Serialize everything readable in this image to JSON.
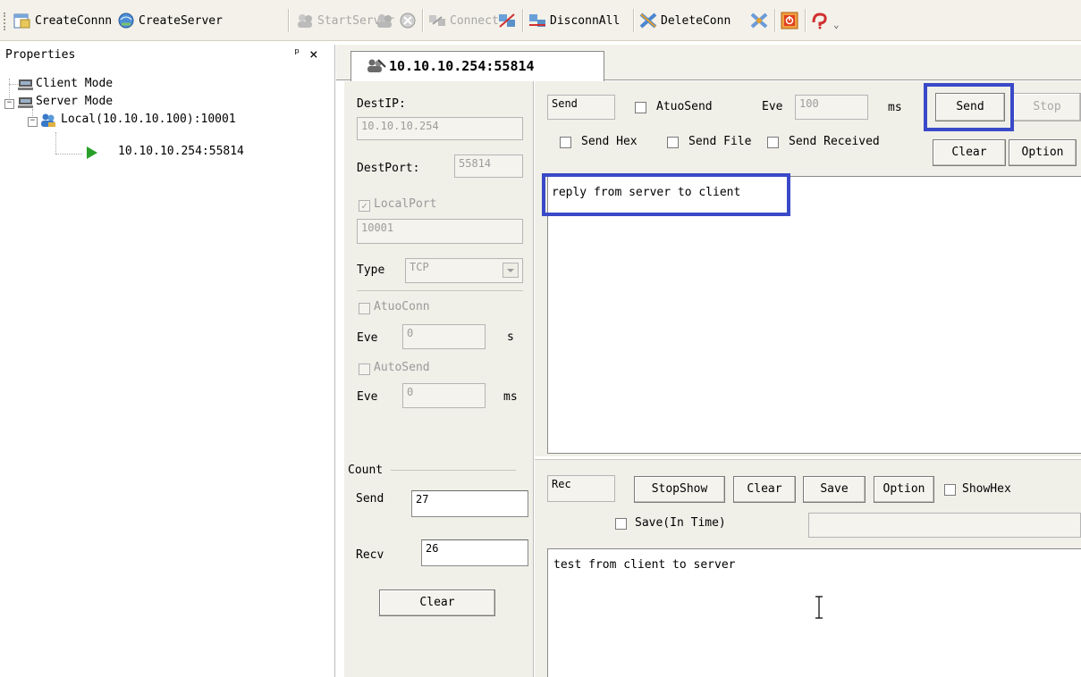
{
  "toolbar": {
    "create_conn": "CreateConnn",
    "create_server": "CreateServer",
    "start_server": "StartServer",
    "connect": "Connect",
    "disconn_all": "DisconnAll",
    "delete_conn": "DeleteConn",
    "overflow": "⌄"
  },
  "props": {
    "title": "Properties",
    "pin": "ᵖ",
    "close": "×",
    "tree": {
      "client_mode": "Client Mode",
      "server_mode": "Server Mode",
      "local": "Local(10.10.10.100):10001",
      "remote": "10.10.10.254:55814",
      "expand_minus": "−"
    }
  },
  "tab": {
    "label": "10.10.10.254:55814"
  },
  "form": {
    "dest_ip_label": "DestIP:",
    "dest_ip_value": "10.10.10.254",
    "dest_port_label": "DestPort:",
    "dest_port_value": "55814",
    "local_port_label": "LocalPort",
    "local_port_value": "10001",
    "type_label": "Type",
    "type_value": "TCP",
    "atuo_conn_label": "AtuoConn",
    "eve_label": "Eve",
    "eve_conn_value": "0",
    "eve_conn_unit": "s",
    "auto_send_label": "AutoSend",
    "eve_send_value": "0",
    "eve_send_unit": "ms",
    "count_label": "Count",
    "send_label": "Send",
    "send_count": "27",
    "recv_label": "Recv",
    "recv_count": "26",
    "clear_label": "Clear"
  },
  "send": {
    "group_label": "Send",
    "atuo_send_label": "AtuoSend",
    "eve_label": "Eve",
    "eve_value": "100",
    "eve_unit": "ms",
    "send_button": "Send",
    "stop_button": "Stop",
    "send_hex": "Send Hex",
    "send_file": "Send File",
    "send_received": "Send Received",
    "clear_button": "Clear",
    "option_button": "Option",
    "text": "reply from server to client"
  },
  "recv": {
    "group_label": "Rec",
    "stop_show": "StopShow",
    "clear": "Clear",
    "save": "Save",
    "option": "Option",
    "show_hex": "ShowHex",
    "save_in_time": "Save(In Time)",
    "text": "test from client to server"
  },
  "colors": {
    "highlight": "#3a49c8"
  }
}
